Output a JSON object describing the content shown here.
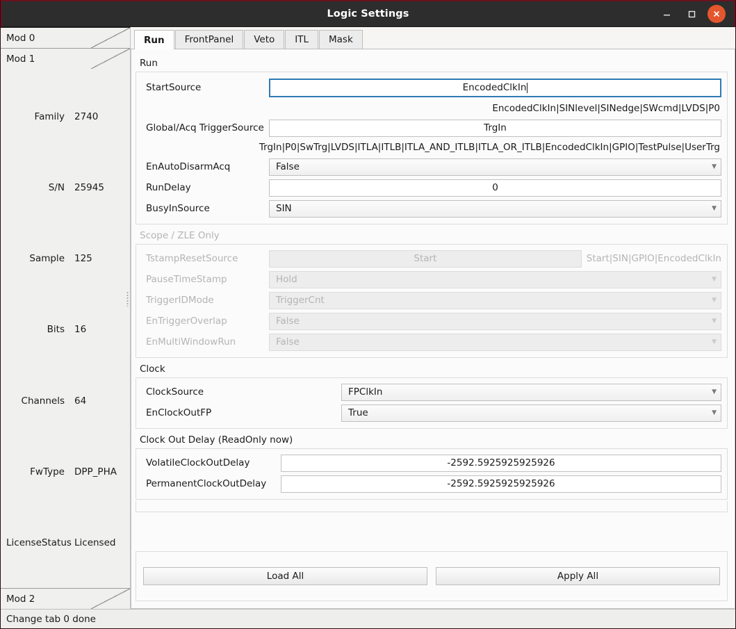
{
  "window": {
    "title": "Logic Settings",
    "minimize_label": "minimize",
    "maximize_label": "maximize",
    "close_label": "close"
  },
  "sidebar": {
    "accordion": [
      {
        "label": "Mod 0"
      },
      {
        "label": "Mod 1"
      },
      {
        "label": "Mod 2"
      }
    ],
    "properties": [
      {
        "key": "Family",
        "value": "2740"
      },
      {
        "key": "S/N",
        "value": "25945"
      },
      {
        "key": "Sample",
        "value": "125"
      },
      {
        "key": "Bits",
        "value": "16"
      },
      {
        "key": "Channels",
        "value": "64"
      },
      {
        "key": "FwType",
        "value": "DPP_PHA"
      },
      {
        "key": "LicenseStatus",
        "value": "Licensed"
      }
    ]
  },
  "tabs": [
    {
      "label": "Run",
      "active": true
    },
    {
      "label": "FrontPanel",
      "active": false
    },
    {
      "label": "Veto",
      "active": false
    },
    {
      "label": "ITL",
      "active": false
    },
    {
      "label": "Mask",
      "active": false
    }
  ],
  "run_group": {
    "title": "Run",
    "start_source": {
      "label": "StartSource",
      "value": "EncodedClkIn",
      "hint": "EncodedClkIn|SINlevel|SINedge|SWcmd|LVDS|P0"
    },
    "trigger_source": {
      "label": "Global/Acq TriggerSource",
      "value": "TrgIn",
      "hint": "TrgIn|P0|SwTrg|LVDS|ITLA|ITLB|ITLA_AND_ITLB|ITLA_OR_ITLB|EncodedClkIn|GPIO|TestPulse|UserTrg"
    },
    "en_auto_disarm_acq": {
      "label": "EnAutoDisarmAcq",
      "value": "False"
    },
    "run_delay": {
      "label": "RunDelay",
      "value": "0"
    },
    "busy_in_source": {
      "label": "BusyInSource",
      "value": "SIN"
    }
  },
  "scope_group": {
    "title": "Scope / ZLE Only",
    "tstamp_reset_source": {
      "label": "TstampResetSource",
      "value": "Start",
      "hint": "Start|SIN|GPIO|EncodedClkIn"
    },
    "pause_timestamp": {
      "label": "PauseTimeStamp",
      "value": "Hold"
    },
    "trigger_id_mode": {
      "label": "TriggerIDMode",
      "value": "TriggerCnt"
    },
    "en_trigger_overlap": {
      "label": "EnTriggerOverlap",
      "value": "False"
    },
    "en_multi_window_run": {
      "label": "EnMultiWindowRun",
      "value": "False"
    }
  },
  "clock_group": {
    "title": "Clock",
    "clock_source": {
      "label": "ClockSource",
      "value": "FPClkIn"
    },
    "en_clock_out_fp": {
      "label": "EnClockOutFP",
      "value": "True"
    }
  },
  "delay_group": {
    "title": "Clock Out Delay (ReadOnly now)",
    "volatile": {
      "label": "VolatileClockOutDelay",
      "value": "-2592.5925925925926"
    },
    "permanent": {
      "label": "PermanentClockOutDelay",
      "value": "-2592.5925925925926"
    }
  },
  "actions": {
    "load_all": "Load All",
    "apply_all": "Apply All"
  },
  "statusbar": {
    "message": "Change tab 0 done"
  },
  "colors": {
    "titlebar_bg": "#2d2d2d",
    "close_button": "#e4572e",
    "focus_border": "#2e7bb5",
    "window_border": "#6b1220",
    "disabled_text": "#b4b4b4"
  }
}
